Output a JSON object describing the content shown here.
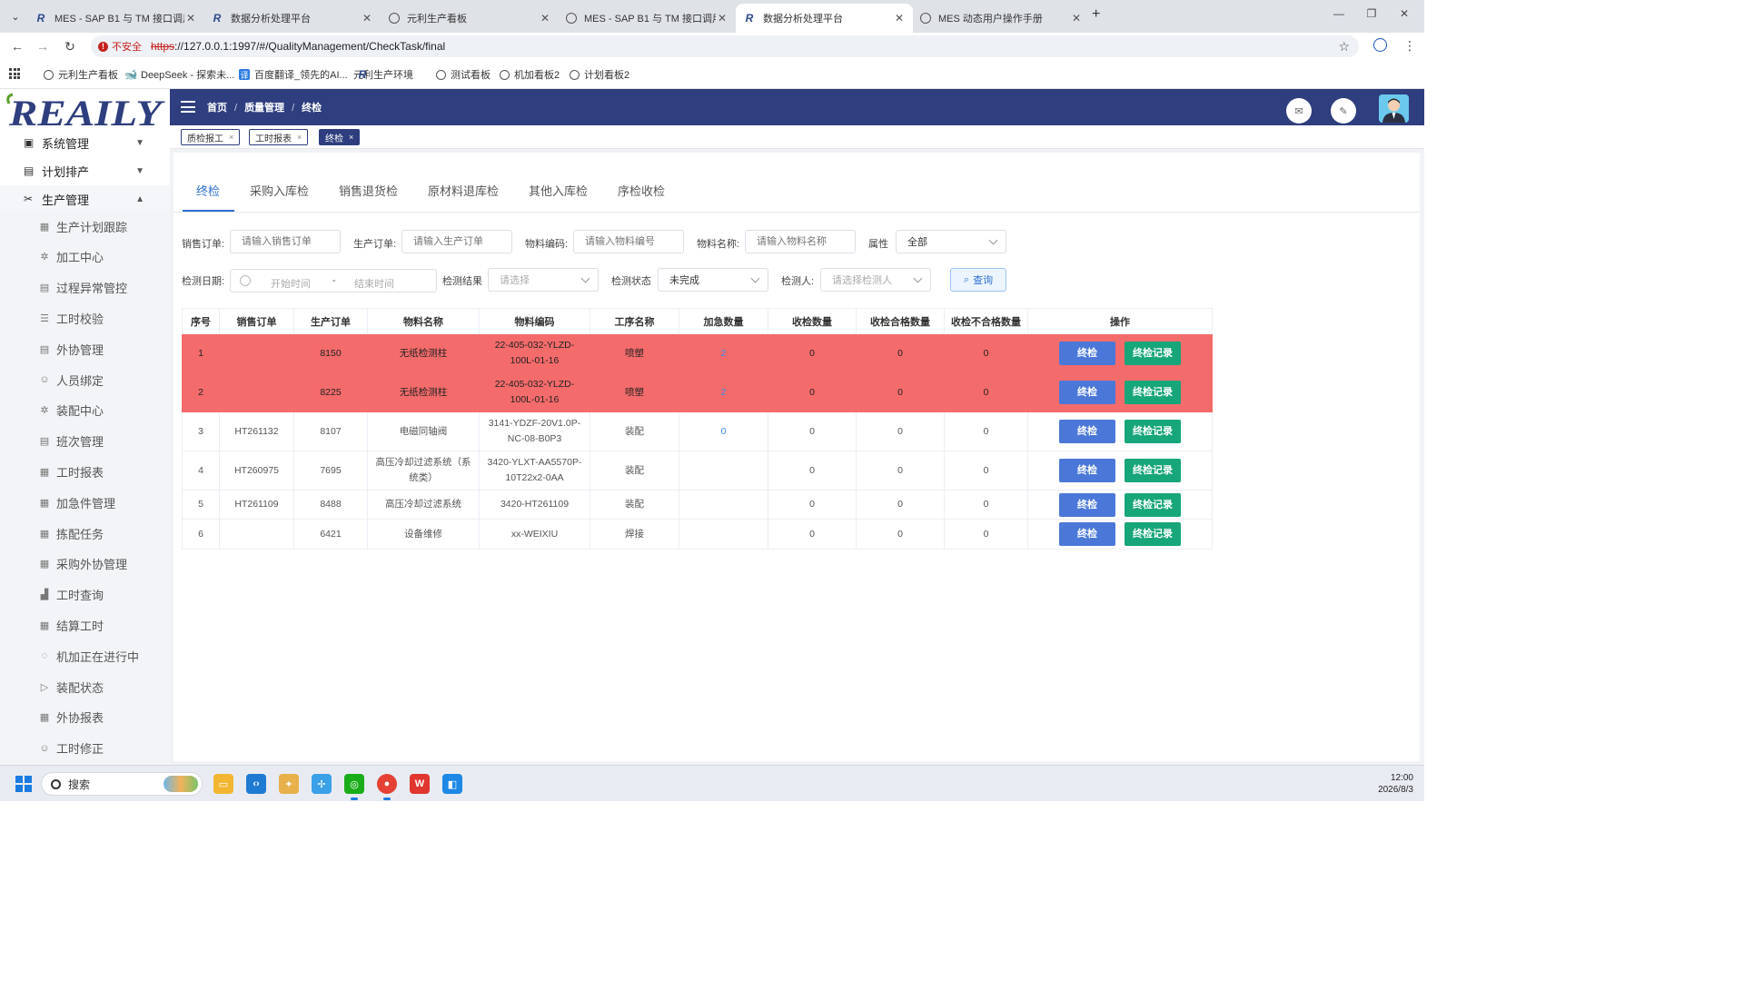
{
  "browser": {
    "tabs": [
      {
        "title": "MES - SAP B1 与 TM 接口调用",
        "favicon": "reaily-logo",
        "active": false
      },
      {
        "title": "数据分析处理平台",
        "favicon": "reaily-logo",
        "active": false
      },
      {
        "title": "元利生产看板",
        "favicon": "globe-icon",
        "active": false
      },
      {
        "title": "MES - SAP B1 与 TM 接口调用",
        "favicon": "globe-icon",
        "active": false
      },
      {
        "title": "数据分析处理平台",
        "favicon": "reaily-logo",
        "active": true
      },
      {
        "title": "MES 动态用户操作手册",
        "favicon": "globe-icon",
        "active": false
      }
    ],
    "security_label": "不安全",
    "url_scheme": "https",
    "url_rest": "://127.0.0.1:1997/#/QualityManagement/CheckTask/final",
    "bookmarks": [
      "元利生产看板",
      "DeepSeek - 探索未...",
      "百度翻译_领先的AI...",
      "元利生产环境",
      "测试看板",
      "机加看板2",
      "计划看板2"
    ]
  },
  "app": {
    "logo_text": "REAILY",
    "breadcrumb": [
      "首页",
      "质量管理",
      "终检"
    ],
    "open_tags": [
      {
        "label": "质检报工",
        "active": false
      },
      {
        "label": "工时报表",
        "active": false
      },
      {
        "label": "终检",
        "active": true
      }
    ],
    "sidebar": {
      "top_menus": [
        {
          "label": "系统管理",
          "icon": "monitor-icon",
          "expanded": false
        },
        {
          "label": "计划排产",
          "icon": "document-icon",
          "expanded": false
        },
        {
          "label": "生产管理",
          "icon": "tools-icon",
          "expanded": true
        }
      ],
      "sub_items": [
        {
          "label": "生产计划跟踪",
          "icon": "grid-icon"
        },
        {
          "label": "加工中心",
          "icon": "gear-icon"
        },
        {
          "label": "过程异常管控",
          "icon": "document-icon"
        },
        {
          "label": "工时校验",
          "icon": "checklist-icon"
        },
        {
          "label": "外协管理",
          "icon": "document-icon"
        },
        {
          "label": "人员绑定",
          "icon": "user-icon"
        },
        {
          "label": "装配中心",
          "icon": "gear-icon"
        },
        {
          "label": "班次管理",
          "icon": "document-icon"
        },
        {
          "label": "工时报表",
          "icon": "grid-icon"
        },
        {
          "label": "加急件管理",
          "icon": "grid-icon"
        },
        {
          "label": "拣配任务",
          "icon": "grid-icon"
        },
        {
          "label": "采购外协管理",
          "icon": "grid-icon"
        },
        {
          "label": "工时查询",
          "icon": "chart-icon"
        },
        {
          "label": "结算工时",
          "icon": "grid-icon"
        },
        {
          "label": "机加正在进行中",
          "icon": "circle-icon"
        },
        {
          "label": "装配状态",
          "icon": "play-icon"
        },
        {
          "label": "外协报表",
          "icon": "grid-icon"
        },
        {
          "label": "工时修正",
          "icon": "user-icon"
        }
      ]
    },
    "inspection_tabs": [
      "终检",
      "采购入库检",
      "销售退货检",
      "原材料退库检",
      "其他入库检",
      "序检收检"
    ],
    "filters": {
      "sales_order": {
        "label": "销售订单:",
        "placeholder": "请输入销售订单"
      },
      "production_order": {
        "label": "生产订单:",
        "placeholder": "请输入生产订单"
      },
      "material_code": {
        "label": "物料编码:",
        "placeholder": "请输入物料编号"
      },
      "material_name": {
        "label": "物料名称:",
        "placeholder": "请输入物料名称"
      },
      "attribute": {
        "label": "属性",
        "value": "全部"
      },
      "date": {
        "label": "检测日期:",
        "start_placeholder": "开始时间",
        "separator": "-",
        "end_placeholder": "结束时间"
      },
      "result": {
        "label": "检测结果",
        "placeholder": "请选择"
      },
      "status": {
        "label": "检测状态",
        "value": "未完成"
      },
      "inspector": {
        "label": "检测人:",
        "placeholder": "请选择检测人"
      },
      "search_label": "查询"
    },
    "table": {
      "headers": [
        "序号",
        "销售订单",
        "生产订单",
        "物料名称",
        "物料编码",
        "工序名称",
        "加急数量",
        "收检数量",
        "收检合格数量",
        "收检不合格数量",
        "操作"
      ],
      "action_labels": [
        "终检",
        "终检记录"
      ],
      "rows": [
        {
          "no": "1",
          "sales_order": "",
          "prod_order": "8150",
          "material_name": "无纸检测柱",
          "material_code": "22-405-032-YLZD-100L-01-16",
          "process": "喷塑",
          "urgent_qty": "2",
          "received": "0",
          "qualified": "0",
          "unqualified": "0",
          "urgent": true
        },
        {
          "no": "2",
          "sales_order": "",
          "prod_order": "8225",
          "material_name": "无纸检测柱",
          "material_code": "22-405-032-YLZD-100L-01-16",
          "process": "喷塑",
          "urgent_qty": "2",
          "received": "0",
          "qualified": "0",
          "unqualified": "0",
          "urgent": true
        },
        {
          "no": "3",
          "sales_order": "HT261132",
          "prod_order": "8107",
          "material_name": "电磁同轴阀",
          "material_code": "3141-YDZF-20V1.0P-NC-08-B0P3",
          "process": "装配",
          "urgent_qty": "0",
          "received": "0",
          "qualified": "0",
          "unqualified": "0",
          "urgent": false
        },
        {
          "no": "4",
          "sales_order": "HT260975",
          "prod_order": "7695",
          "material_name": "高压冷却过滤系统（系统类）",
          "material_code": "3420-YLXT-AA5570P-10T22x2-0AA",
          "process": "装配",
          "urgent_qty": "",
          "received": "0",
          "qualified": "0",
          "unqualified": "0",
          "urgent": false
        },
        {
          "no": "5",
          "sales_order": "HT261109",
          "prod_order": "8488",
          "material_name": "高压冷却过滤系统",
          "material_code": "3420-HT261109",
          "process": "装配",
          "urgent_qty": "",
          "received": "0",
          "qualified": "0",
          "unqualified": "0",
          "urgent": false
        },
        {
          "no": "6",
          "sales_order": "",
          "prod_order": "6421",
          "material_name": "设备维修",
          "material_code": "xx-WEIXIU",
          "process": "焊接",
          "urgent_qty": "",
          "received": "0",
          "qualified": "0",
          "unqualified": "0",
          "urgent": false
        }
      ]
    }
  },
  "taskbar": {
    "search_label": "搜索",
    "time": "12:00",
    "date": "2026/8/3"
  }
}
